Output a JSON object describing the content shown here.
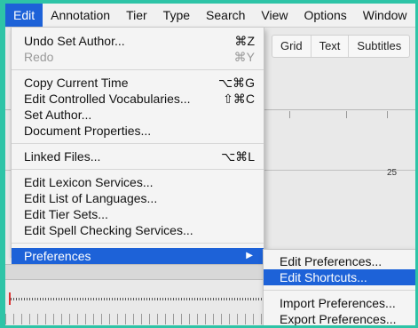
{
  "menubar": {
    "items": [
      "Edit",
      "Annotation",
      "Tier",
      "Type",
      "Search",
      "View",
      "Options",
      "Window"
    ]
  },
  "background": {
    "tabs": [
      "Grid",
      "Text",
      "Subtitles"
    ],
    "ruler_label": "25"
  },
  "edit_menu": {
    "groups": [
      [
        {
          "label": "Undo Set Author...",
          "shortcut": "⌘Z",
          "enabled": true
        },
        {
          "label": "Redo",
          "shortcut": "⌘Y",
          "enabled": false
        }
      ],
      [
        {
          "label": "Copy Current Time",
          "shortcut": "⌥⌘G",
          "enabled": true
        },
        {
          "label": "Edit Controlled Vocabularies...",
          "shortcut": "⇧⌘C",
          "enabled": true
        },
        {
          "label": "Set Author...",
          "shortcut": "",
          "enabled": true
        },
        {
          "label": "Document Properties...",
          "shortcut": "",
          "enabled": true
        }
      ],
      [
        {
          "label": "Linked Files...",
          "shortcut": "⌥⌘L",
          "enabled": true
        }
      ],
      [
        {
          "label": "Edit Lexicon Services...",
          "shortcut": "",
          "enabled": true
        },
        {
          "label": "Edit List of Languages...",
          "shortcut": "",
          "enabled": true
        },
        {
          "label": "Edit Tier Sets...",
          "shortcut": "",
          "enabled": true
        },
        {
          "label": "Edit Spell Checking Services...",
          "shortcut": "",
          "enabled": true
        }
      ]
    ],
    "preferences_label": "Preferences",
    "preferences_arrow": "▶"
  },
  "submenu": {
    "items": [
      {
        "label": "Edit Preferences...",
        "highlighted": false
      },
      {
        "label": "Edit Shortcuts...",
        "highlighted": true
      },
      {
        "label": "Import Preferences...",
        "highlighted": false
      },
      {
        "label": "Export Preferences...",
        "highlighted": false
      }
    ]
  },
  "colors": {
    "outer_border": "#2ec4a7",
    "highlight": "#1d62d8"
  }
}
